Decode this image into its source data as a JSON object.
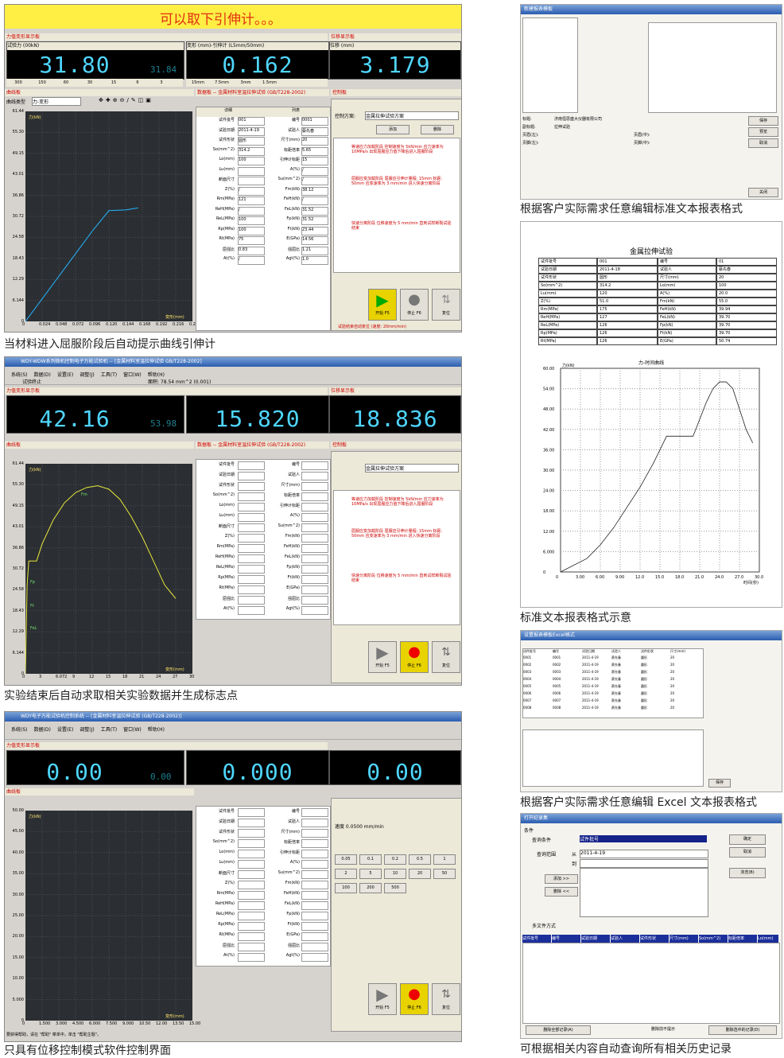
{
  "captions": {
    "s1": "当材料进入屈服阶段后自动提示曲线引伸计",
    "s2": "实验结束后自动求取相关实验数据并生成标志点",
    "s3": "只具有位移控制模式软件控制界面",
    "r1": "根据客户实际需求任意编辑标准文本报表格式",
    "r2": "标准文本报表格式示意",
    "r3": "根据客户实际需求任意编辑 Excel 文本报表格式",
    "r4": "可根据相关内容自动查询所有相关历史记录"
  },
  "shot1": {
    "banner": "可以取下引伸计。。。",
    "force_value": "31.80",
    "force_peak": "31.84",
    "deform_value": "0.162",
    "disp_value": "3.179",
    "force_header": "试验力 (00kN)",
    "deform_header": "变形 (mm)-引伸计 (L5mm/50mm)",
    "disp_header": "位移 (mm)",
    "unit_zero": "0.0"
  },
  "shot2": {
    "title": "WDY-WDW系列微机控制电子万能试验机 -- [金属材料室温拉伸试验 GB/T228-2002]",
    "force_value": "42.16",
    "force_peak": "53.98",
    "deform_value": "15.820",
    "disp_value": "18.836",
    "status": "试验终止",
    "area": "面积: 78.54 mm^2 (0.001)"
  },
  "shot3": {
    "title": "WDY电子万能试验机控制系统 -- [金属材料室温拉伸试验 (GB/T228-2002)]",
    "force_value": "0.00",
    "force_peak": "0.00",
    "deform_value": "0.000",
    "disp_value": "0.00",
    "statusbar": "要获得帮助，请在 \"帮助\" 菜单中，单击 \"帮助主题\"。",
    "speed_label": "速度 0.0500 mm/min"
  },
  "menus": [
    "系统(S)",
    "数据(D)",
    "设置(E)",
    "调整(J)",
    "工具(T)",
    "窗口(W)",
    "帮助(H)"
  ],
  "toolbar_right": [
    "清零",
    "分析区",
    "数据板",
    "前翻",
    "后翻"
  ],
  "scales": [
    "300",
    "150",
    "60",
    "30",
    "15",
    "6",
    "3"
  ],
  "deform_scales": [
    "15mm",
    "7.5mm",
    "3mm",
    "1.5mm"
  ],
  "panels": {
    "curve": "曲线板",
    "curve_type_label": "曲线类型",
    "curve_type": "力-变形",
    "data": "数据板 -- 金属材料室温拉伸试验 (GB/T228-2002)",
    "control": "控制板",
    "force_panel": "力值变形显示板",
    "disp_panel": "位移显示板",
    "col_detail": "详细",
    "col_list": "列表",
    "plan_label": "控制方案:",
    "plan_value": "金属拉伸试验方案",
    "add": "添加",
    "delete": "删除",
    "start": "开始 F5",
    "stop": "停止 F6",
    "reset": "复位",
    "check_text": "试验结束自动复位 (速度: 20mm/min)"
  },
  "fields_left": [
    {
      "k": "试件批号",
      "v": "001"
    },
    {
      "k": "试验日期",
      "v": "2011-4-19"
    },
    {
      "k": "试件形状",
      "v": "圆形"
    },
    {
      "k": "So(mm^2)",
      "v": "314.2"
    },
    {
      "k": "Lo(mm)",
      "v": "100"
    },
    {
      "k": "Lu(mm)",
      "v": ""
    },
    {
      "k": "断面尺寸",
      "v": ""
    },
    {
      "k": "Z(%)",
      "v": "/"
    },
    {
      "k": "Rm(MPa)",
      "v": "121"
    },
    {
      "k": "ReH(MPa)",
      "v": "/"
    },
    {
      "k": "ReL(MPa)",
      "v": "100"
    },
    {
      "k": "Rp(MPa)",
      "v": "100"
    },
    {
      "k": "Rt(MPa)",
      "v": "75"
    },
    {
      "k": "屈强比",
      "v": "0.83"
    },
    {
      "k": "At(%)",
      "v": "/"
    }
  ],
  "fields_right": [
    {
      "k": "编号",
      "v": "0001"
    },
    {
      "k": "试验人",
      "v": "蔡先春"
    },
    {
      "k": "尺寸(mm)",
      "v": "20"
    },
    {
      "k": "标距倍率",
      "v": "5.65"
    },
    {
      "k": "引伸计标距",
      "v": "15"
    },
    {
      "k": "A(%)",
      "v": "/"
    },
    {
      "k": "Su(mm^2)",
      "v": "/"
    },
    {
      "k": "Fm(kN)",
      "v": "38.12"
    },
    {
      "k": "FeH(kN)",
      "v": "/"
    },
    {
      "k": "FeL(kN)",
      "v": "31.52"
    },
    {
      "k": "Fp(kN)",
      "v": "31.52"
    },
    {
      "k": "Ft(kN)",
      "v": "23.44"
    },
    {
      "k": "E(GPa)",
      "v": "14.56"
    },
    {
      "k": "强屈比",
      "v": "1.21"
    },
    {
      "k": "Agt(%)",
      "v": "1.0"
    }
  ],
  "steps": [
    "等速应力加载阶段 控制速度为 5kN/min 应力速率为 10MPa/s 出现屈服应力值下降后进入屈服阶段",
    "屈服应变加载阶段 屈服应引伸计量程: 15mm 标距: 50mm 应变速率为 3 mm/min 进入快速分离阶段",
    "快速分离阶段 位移速度为 5 mm/min 直到试样断裂试验结束"
  ],
  "speed_buttons": [
    "0.05",
    "0.1",
    "0.2",
    "0.5",
    "1",
    "2",
    "5",
    "10",
    "20",
    "50",
    "100",
    "200",
    "500"
  ],
  "chart1": {
    "type": "line",
    "title": "",
    "xlabel": "变形(mm)",
    "ylabel": "力(kN)",
    "y_ticks": [
      "61.44",
      "55.30",
      "49.15",
      "43.01",
      "36.86",
      "30.72",
      "24.58",
      "18.43",
      "12.29",
      "6.144",
      "0"
    ],
    "x_ticks": [
      "0",
      "0.024",
      "0.048",
      "0.072",
      "0.096",
      "0.120",
      "0.144",
      "0.168",
      "0.192",
      "0.216",
      "0.240"
    ],
    "x": [
      0,
      0.024,
      0.048,
      0.072,
      0.096,
      0.12,
      0.144,
      0.162
    ],
    "y": [
      0,
      6.6,
      13.2,
      19.8,
      26.4,
      32.4,
      32.6,
      33.2
    ],
    "xlim": [
      0,
      0.24
    ],
    "ylim": [
      0,
      61.44
    ]
  },
  "chart2": {
    "type": "line",
    "xlabel": "变形(mm)",
    "ylabel": "力(kN)",
    "y_ticks": [
      "61.44",
      "55.30",
      "49.15",
      "43.01",
      "36.86",
      "30.72",
      "24.58",
      "18.43",
      "12.29",
      "6.144",
      "0"
    ],
    "x_ticks": [
      "0",
      "3",
      "6.072",
      "9",
      "12",
      "15",
      "18",
      "21",
      "24",
      "27",
      "30"
    ],
    "x": [
      0,
      0.3,
      0.6,
      1.2,
      2,
      3,
      5,
      7,
      9,
      11,
      13,
      15,
      17,
      19,
      21,
      23,
      25,
      26,
      27
    ],
    "y": [
      0,
      26,
      33,
      33,
      33,
      38,
      45,
      50,
      53,
      54.5,
      55,
      54,
      51,
      46,
      40,
      33,
      26,
      24,
      22
    ],
    "xlim": [
      0,
      30
    ],
    "ylim": [
      0,
      61.44
    ],
    "annotations": [
      "Fp",
      "Ft",
      "FeL",
      "Fm"
    ]
  },
  "chart3": {
    "type": "line",
    "xlabel": "变形(mm)",
    "ylabel": "力(kN)",
    "y_ticks": [
      "50.00",
      "45.00",
      "40.00",
      "35.00",
      "30.00",
      "25.00",
      "20.00",
      "15.00",
      "10.00",
      "5.000",
      "0"
    ],
    "x_ticks": [
      "0",
      "1.500",
      "3.000",
      "4.500",
      "6.000",
      "7.500",
      "9.000",
      "10.50",
      "12.00",
      "13.50",
      "15.00"
    ],
    "xlim": [
      0,
      15
    ],
    "ylim": [
      0,
      50
    ]
  },
  "report": {
    "title": "金属拉伸试验",
    "chart_title": "力-时间曲线",
    "ylabel": "力(kN)",
    "xlabel": "时间(秒)",
    "y_ticks": [
      "60.00",
      "54.00",
      "48.00",
      "42.00",
      "36.00",
      "30.00",
      "24.00",
      "18.00",
      "12.00",
      "6.000",
      "0"
    ],
    "x_ticks": [
      "0",
      "3.00",
      "6.00",
      "9.00",
      "12.0",
      "15.0",
      "18.0",
      "21.0",
      "24.0",
      "27.0",
      "30.0"
    ],
    "x": [
      0,
      4,
      6,
      8,
      10,
      12,
      14,
      15,
      16,
      18,
      20,
      21,
      22,
      23,
      24,
      25,
      26,
      27,
      28,
      29
    ],
    "y": [
      0,
      4,
      8,
      13,
      19,
      25,
      32,
      36,
      40,
      40,
      40,
      45,
      50,
      54,
      56,
      56,
      54,
      48,
      42,
      38
    ],
    "rows": [
      [
        "试件批号",
        "001",
        "编号",
        "01"
      ],
      [
        "试验日期",
        "2011-4-18",
        "试验人",
        "蔡先春"
      ],
      [
        "试件形状",
        "圆形",
        "尺寸(mm)",
        "20"
      ],
      [
        "So(mm^2)",
        "314.2",
        "Lo(mm)",
        "100"
      ],
      [
        "Lu(mm)",
        "120",
        "A(%)",
        "20.0"
      ],
      [
        "Z(%)",
        "51.0",
        "Fm(kN)",
        "55.0"
      ],
      [
        "Rm(MPa)",
        "175",
        "FeH(kN)",
        "39.94"
      ],
      [
        "ReH(MPa)",
        "127",
        "FeL(kN)",
        "39.70"
      ],
      [
        "ReL(MPa)",
        "126",
        "Fp(kN)",
        "39.70"
      ],
      [
        "Rp(MPa)",
        "126",
        "Ft(kN)",
        "39.70"
      ],
      [
        "Rt(MPa)",
        "126",
        "E(GPa)",
        "50.74"
      ]
    ]
  },
  "dialogs": {
    "report_edit_title": "新建报表模板",
    "excel_title": "设置报表模板Excel格式",
    "history_title": "打开纪录集",
    "history_condition": "条件",
    "history_query": "查询条件",
    "history_query_value": "试件批号",
    "history_range": "查询范围",
    "history_from": "从",
    "history_to": "到",
    "history_date": "2011-4-19",
    "history_add": "添加 >>",
    "history_del": "删除 <<",
    "history_multi": "多文件方式",
    "history_ok": "确定",
    "history_cancel": "取消",
    "history_browse": "浏览(B)",
    "history_cols": [
      "试件批号",
      "编号",
      "试验日期",
      "试验人",
      "试件形状",
      "尺寸(mm)",
      "So(mm^2)",
      "标距倍率",
      "Lo(mm)"
    ],
    "history_bottom": [
      "删除全部记录(A)",
      "删除前不提示",
      "删除选中的记录(D)"
    ],
    "report_buttons": [
      "保存",
      "预览",
      "取消"
    ],
    "report_fields": [
      "标题:",
      "副标题:",
      "页眉(左):",
      "页眉(中):",
      "页脚(左):",
      "页脚(中):"
    ],
    "report_title_value": "济南恒思盛大仪器有限公司",
    "report_sub_value": "拉伸试验",
    "report_close": "关闭",
    "excel_items": [
      "试件批号",
      "编号",
      "试验日期",
      "试验人",
      "试件形状",
      "尺寸(mm)"
    ],
    "excel_sample_rows": [
      [
        "0001",
        "0001",
        "2011-4-19",
        "蔡先春",
        "圆形",
        "20"
      ],
      [
        "0002",
        "0002",
        "2011-4-19",
        "蔡先春",
        "圆形",
        "20"
      ],
      [
        "0003",
        "0003",
        "2011-4-19",
        "蔡先春",
        "圆形",
        "20"
      ],
      [
        "0004",
        "0004",
        "2011-4-19",
        "蔡先春",
        "圆形",
        "20"
      ],
      [
        "0005",
        "0005",
        "2011-4-19",
        "蔡先春",
        "圆形",
        "20"
      ],
      [
        "0006",
        "0006",
        "2011-4-19",
        "蔡先春",
        "圆形",
        "20"
      ],
      [
        "0007",
        "0007",
        "2011-4-19",
        "蔡先春",
        "圆形",
        "20"
      ],
      [
        "0008",
        "0008",
        "2011-4-19",
        "蔡先春",
        "圆形",
        "20"
      ]
    ]
  },
  "colors": {
    "lcd": "#4fd6ff",
    "plot_bg": "#2b2f33",
    "curve1": "#23b3ff",
    "curve2": "#e8e83a",
    "banner_bg": "#ffee44",
    "banner_text": "#e03010"
  }
}
